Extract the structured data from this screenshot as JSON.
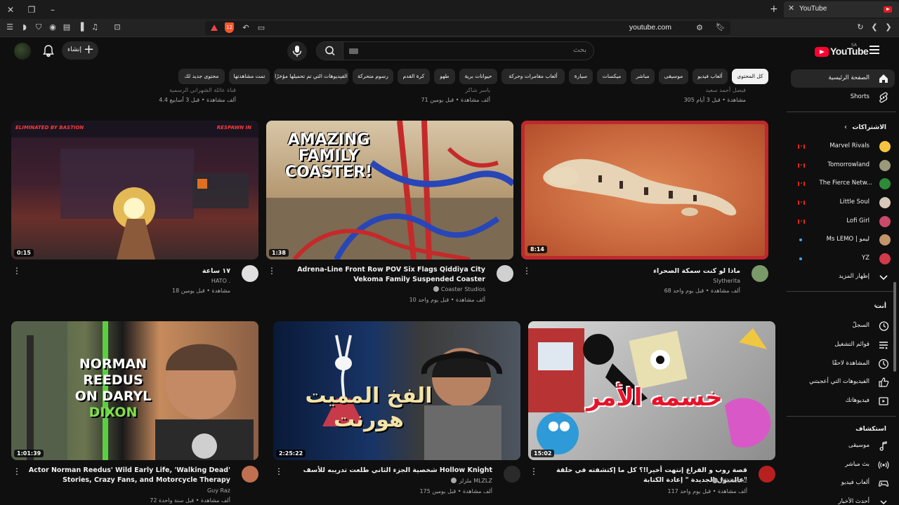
{
  "browser": {
    "tab_title": "YouTube",
    "url": "youtube.com",
    "shield_count": "12"
  },
  "masthead": {
    "logo_text": "YouTube",
    "logo_region": "SA",
    "search_placeholder": "بحث",
    "create_label": "إنشاء"
  },
  "chips": [
    "كل المحتوى",
    "ألعاب فيديو",
    "موسيقى",
    "مباشر",
    "ميكسات",
    "سيارة",
    "ألعاب مغامرات وحركة",
    "حيوانات برية",
    "طهو",
    "كرة القدم",
    "رسوم متحركة",
    "الفيديوهات التي تم تحميلها مؤخرًا",
    "تمت مشاهدتها",
    "محتوى جديد لك"
  ],
  "sidebar": {
    "home": "الصفحة الرئيسية",
    "shorts": "Shorts",
    "subscriptions_header": "الاشتراكات",
    "subscriptions": [
      {
        "name": "Marvel Rivals",
        "status": "live",
        "color": "#f4c542"
      },
      {
        "name": "Tomorrowland",
        "status": "live",
        "color": "#9a9a7a"
      },
      {
        "name": "The Fierce Netw...",
        "status": "live",
        "color": "#2e8b3a"
      },
      {
        "name": "Little Soul",
        "status": "live",
        "color": "#d8c8b8"
      },
      {
        "name": "Lofi Girl",
        "status": "live",
        "color": "#c94a6a"
      },
      {
        "name": "Ms LEMO | ليمو",
        "status": "new",
        "color": "#c4956a"
      },
      {
        "name": "YZ",
        "status": "new",
        "color": "#d23a4a"
      }
    ],
    "show_more": "إظهار المزيد",
    "you_header": "أنت",
    "you_items": [
      "السجلّ",
      "قوائم التشغيل",
      "المشاهدة لاحقًا",
      "الفيديوهات التي أعجبتني",
      "فيديوهاتك"
    ],
    "explore_header": "استكشاف",
    "explore_items": [
      "موسيقى",
      "بث مباشر",
      "ألعاب فيديو",
      "أحدث الأخبار"
    ]
  },
  "top_row": [
    {
      "meta": "305 مشاهدة • قبل 3 أيام",
      "channel": "فيصل أحمد سعيد"
    },
    {
      "meta": "71 ألف مشاهدة • قبل يومين",
      "channel": "ياسر شاكر"
    },
    {
      "meta": "4.4 ألف مشاهدة • قبل 3 أسابيع",
      "channel": "قناة عائلة الشهراني الرسمية"
    }
  ],
  "videos": [
    {
      "title": "ماذا لو كنت سمكة الصحراء",
      "channel": "Slytherita",
      "meta": "68 ألف مشاهدة • قبل يوم واحد",
      "duration": "8:14",
      "verified": false,
      "avatar_color": "#7a9a6a"
    },
    {
      "title": "Adrena-Line Front Row POV Six Flags Qiddiya City Vekoma Family Suspended Coaster",
      "channel": "Coaster Studios",
      "meta": "10 ألف مشاهدة • قبل يوم واحد",
      "duration": "1:38",
      "verified": true,
      "thumb_text": "AMAZING FAMILY COASTER!",
      "avatar_color": "#d0d0d0"
    },
    {
      "title": "١٧ ساعة",
      "channel": "HATO .",
      "meta": "18 مشاهدة • قبل يومين",
      "duration": "0:15",
      "verified": false,
      "thumb_text_left": "ELIMINATED BY BASTION",
      "thumb_text_right": "RESPAWN IN",
      "avatar_color": "#e0e0e0"
    },
    {
      "title": "قصة روب و الفراغ إنتهت أخيرا!؟ كل ما إكتشفته في حلقة عالمبول الجديدة \" إعادة الكتابة\"",
      "channel": "Wikitoonz",
      "meta": "117 ألف مشاهدة • قبل يوم واحد",
      "duration": "15:02",
      "verified": true,
      "thumb_text": "خسمه الأمر",
      "avatar_color": "#b82020"
    },
    {
      "title": "شخصية الجزء الثاني طلعت تدريبه للأسف Hollow Knight",
      "channel": "ملزلز MLZLZ",
      "meta": "175 ألف مشاهدة • قبل يومين",
      "duration": "2:25:22",
      "verified": true,
      "thumb_text": "الفخ المميت هورنت",
      "avatar_color": "#2a2a2a"
    },
    {
      "title": "Actor Norman Reedus' Wild Early Life, 'Walking Dead' Stories, Crazy Fans, and Motorcycle Therapy",
      "channel": "Guy Raz",
      "meta": "72 ألف مشاهدة • قبل سنة واحدة",
      "duration": "1:01:39",
      "verified": false,
      "thumb_text_1": "NORMAN",
      "thumb_text_2": "REEDUS",
      "thumb_text_3": "ON DARYL",
      "thumb_text_4": "DIXON",
      "avatar_color": "#c07050"
    }
  ]
}
